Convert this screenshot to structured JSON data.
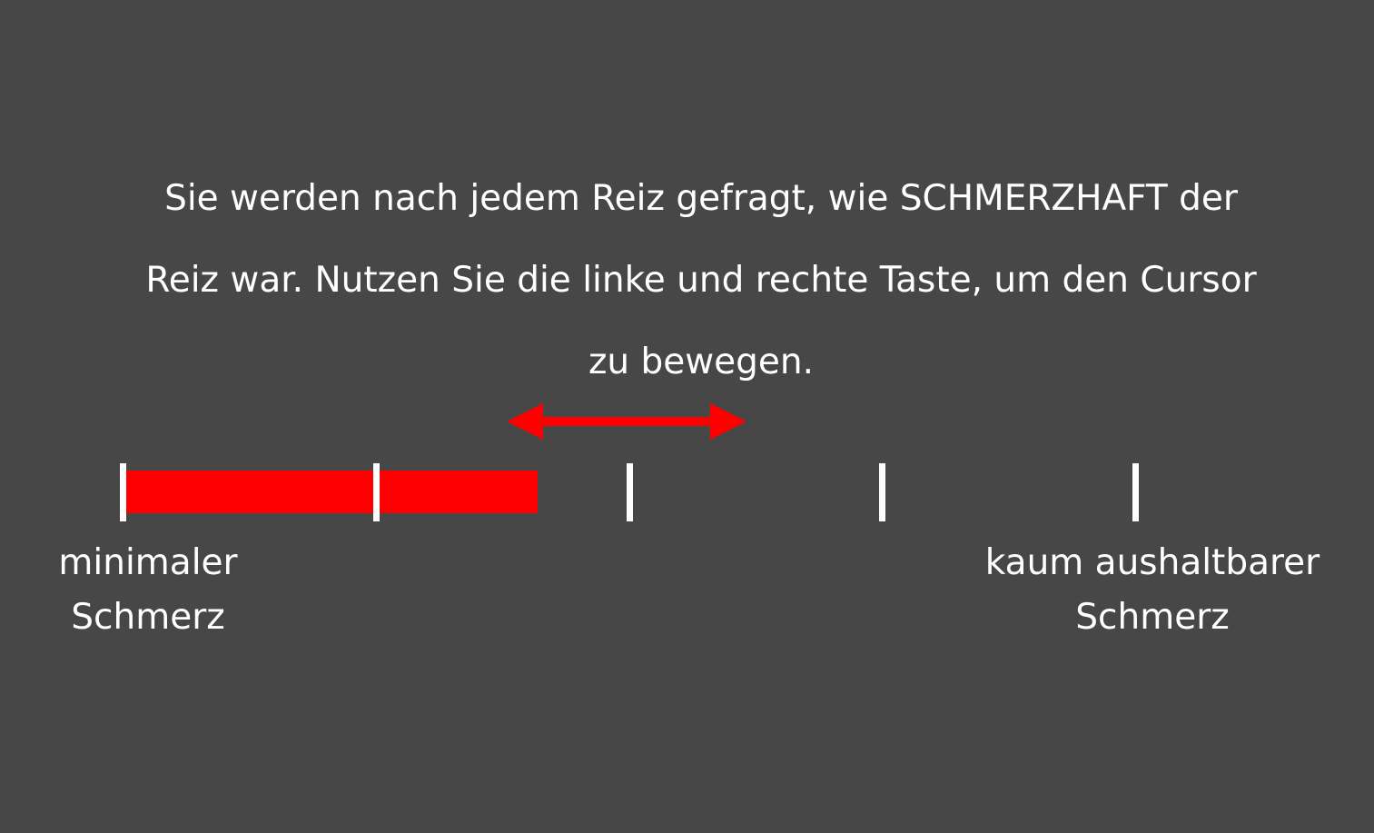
{
  "screen": {
    "background": "#474747",
    "text_color": "#ffffff",
    "accent": "#ff0000"
  },
  "instructions": {
    "lines": [
      "Sie werden nach jedem Reiz gefragt, wie SCHMERZHAFT der",
      "Reiz war. Nutzen Sie die linke und rechte Taste, um den Cursor",
      "zu bewegen."
    ]
  },
  "arrow": {
    "icon": "double-arrow-left-right-icon",
    "color": "#ff0000"
  },
  "rating_scale": {
    "tick_count": 5,
    "fill_fraction": 0.41,
    "fill_color": "#ff0000",
    "tick_color": "#ffffff",
    "anchors": {
      "left": [
        "minimaler",
        "Schmerz"
      ],
      "right": [
        "kaum aushaltbarer",
        "Schmerz"
      ]
    }
  }
}
